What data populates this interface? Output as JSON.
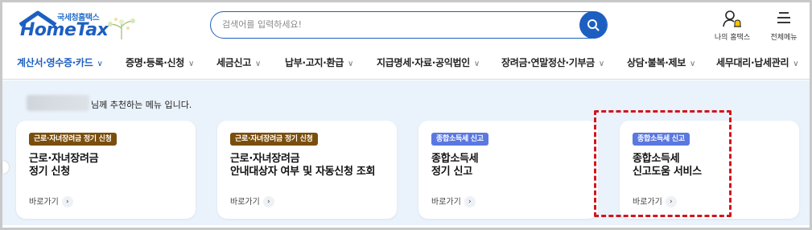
{
  "header": {
    "logo_sub": "국세청홈택스",
    "logo_main": "HomeTax",
    "search_placeholder": "검색어를 입력하세요!",
    "my_hometax": "나의 홈택스",
    "all_menu": "전체메뉴"
  },
  "nav": {
    "items": [
      {
        "label": "계산서·영수증·카드"
      },
      {
        "label": "증명·등록·신청"
      },
      {
        "label": "세금신고"
      },
      {
        "label": "납부·고지·환급"
      },
      {
        "label": "지급명세·자료·공익법인"
      },
      {
        "label": "장려금·연말정산·기부금"
      },
      {
        "label": "상담·불복·제보"
      },
      {
        "label": "세무대리·납세관리"
      }
    ]
  },
  "recommend": {
    "message": "님께 추천하는 메뉴 입니다."
  },
  "cards": [
    {
      "badge": "근로·자녀장려금 정기 신청",
      "title_1": "근로·자녀장려금",
      "title_2": "정기 신청",
      "link": "바로가기"
    },
    {
      "badge": "근로·자녀장려금 정기 신청",
      "title_1": "근로·자녀장려금",
      "title_2": "안내대상자 여부 및 자동신청 조회",
      "link": "바로가기"
    },
    {
      "badge": "종합소득세 신고",
      "title_1": "종합소득세",
      "title_2": "정기 신고",
      "link": "바로가기"
    },
    {
      "badge": "종합소득세 신고",
      "title_1": "종합소득세",
      "title_2": "신고도움 서비스",
      "link": "바로가기"
    }
  ],
  "colors": {
    "brand": "#1d5fc1",
    "badge_brown": "#7a4e0d",
    "badge_blue": "#5b78e0",
    "highlight_dash": "#d2151c",
    "panel_bg": "#eaf2fb"
  },
  "icons": {
    "search": "search-icon",
    "my_hometax": "user-bell-icon",
    "all_menu": "hamburger-icon",
    "chevron": "chevron-down-icon",
    "go": "chevron-right-icon"
  }
}
